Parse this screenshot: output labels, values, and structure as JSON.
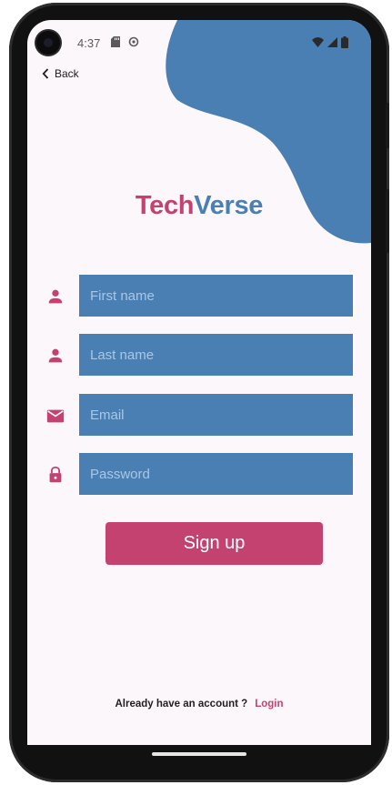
{
  "status_bar": {
    "time": "4:37",
    "left_icons": [
      "sd-card-icon",
      "sync-icon"
    ],
    "right_icons": [
      "wifi-icon",
      "signal-icon",
      "battery-icon"
    ]
  },
  "nav": {
    "back_label": "Back"
  },
  "brand": {
    "part1": "Tech",
    "part2": "Verse",
    "color1": "#c4426f",
    "color2": "#4a7fb3"
  },
  "form": {
    "fields": [
      {
        "icon": "person-icon",
        "placeholder": "First name",
        "value": ""
      },
      {
        "icon": "person-icon",
        "placeholder": "Last name",
        "value": ""
      },
      {
        "icon": "mail-icon",
        "placeholder": "Email",
        "value": ""
      },
      {
        "icon": "lock-icon",
        "placeholder": "Password",
        "value": ""
      }
    ],
    "submit_label": "Sign up"
  },
  "footer": {
    "prompt": "Already have an account ?",
    "login_label": "Login"
  },
  "colors": {
    "accent": "#c4426f",
    "primary": "#4a7fb3",
    "background": "#fcf7fb"
  }
}
